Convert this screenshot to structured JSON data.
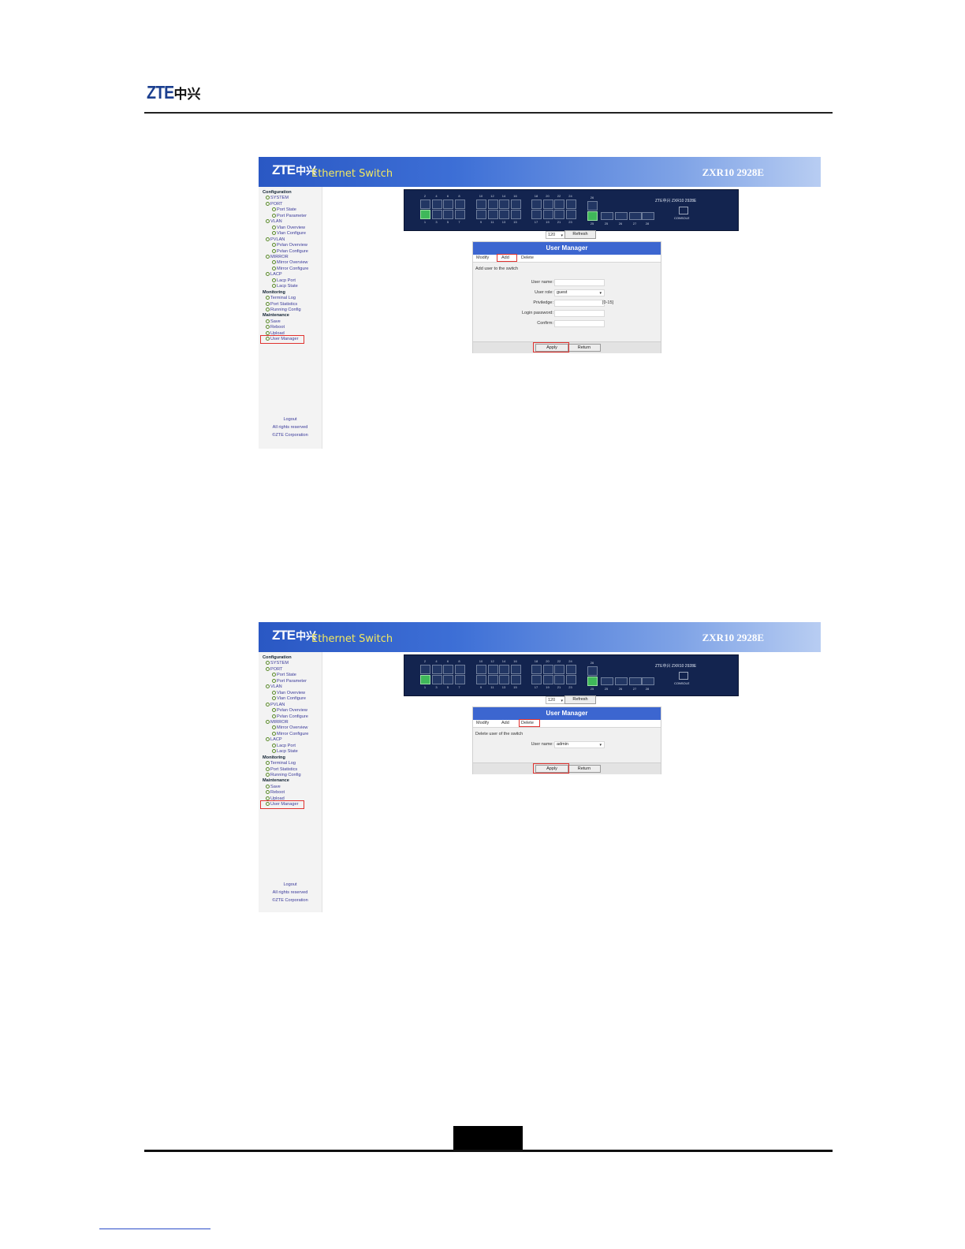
{
  "document": {
    "logo_latin": "ZTE",
    "logo_cn": "中兴"
  },
  "screens": [
    {
      "banner": {
        "logo": "ZTE",
        "logo_cn": "中兴",
        "product": "Ethernet Switch",
        "model": "ZXR10 2928E"
      },
      "sidebar": {
        "items": [
          {
            "label": "Configuration",
            "type": "head"
          },
          {
            "label": "SYSTEM",
            "type": "item"
          },
          {
            "label": "PORT",
            "type": "item"
          },
          {
            "label": "Port State",
            "type": "sub"
          },
          {
            "label": "Port Parameter",
            "type": "sub"
          },
          {
            "label": "VLAN",
            "type": "item"
          },
          {
            "label": "Vlan Overview",
            "type": "sub"
          },
          {
            "label": "Vlan Configure",
            "type": "sub"
          },
          {
            "label": "PVLAN",
            "type": "item"
          },
          {
            "label": "Pvlan Overview",
            "type": "sub"
          },
          {
            "label": "Pvlan Configure",
            "type": "sub"
          },
          {
            "label": "MIRROR",
            "type": "item"
          },
          {
            "label": "Mirror Overview",
            "type": "sub"
          },
          {
            "label": "Mirror Configure",
            "type": "sub"
          },
          {
            "label": "LACP",
            "type": "item"
          },
          {
            "label": "Lacp Port",
            "type": "sub"
          },
          {
            "label": "Lacp State",
            "type": "sub"
          },
          {
            "label": "Monitoring",
            "type": "head"
          },
          {
            "label": "Terminal Log",
            "type": "item"
          },
          {
            "label": "Port Statistics",
            "type": "item"
          },
          {
            "label": "Running Config",
            "type": "item"
          },
          {
            "label": "Maintenance",
            "type": "head"
          },
          {
            "label": "Save",
            "type": "item"
          },
          {
            "label": "Reboot",
            "type": "item"
          },
          {
            "label": "Upload",
            "type": "item"
          },
          {
            "label": "User Manager",
            "type": "item"
          }
        ],
        "footer": [
          "Logout",
          "All rights reserved",
          "©ZTE Corporation"
        ]
      },
      "panel": {
        "top_numbers": [
          "2",
          "4",
          "6",
          "8",
          "10",
          "12",
          "14",
          "16",
          "18",
          "20",
          "22",
          "24"
        ],
        "bottom_numbers": [
          "1",
          "3",
          "5",
          "7",
          "9",
          "11",
          "13",
          "15",
          "17",
          "19",
          "21",
          "23"
        ],
        "port26_top": "26",
        "port25_bottom": "25",
        "sfp_numbers": [
          "25",
          "26",
          "27",
          "28"
        ],
        "brand": "ZTE中兴  ZXR10 2928E",
        "console": "CONSOLE"
      },
      "refresh": {
        "interval": "120",
        "button": "Refresh"
      },
      "user_manager": {
        "title": "User Manager",
        "tabs": [
          "Modify",
          "Add",
          "Delete"
        ],
        "description": "Add user to the switch",
        "fields": [
          {
            "label": "User name:",
            "value": ""
          },
          {
            "label": "User role:",
            "value": "guest"
          },
          {
            "label": "Priviledge:",
            "value": "",
            "hint": "[0-15]"
          },
          {
            "label": "Login password:",
            "value": ""
          },
          {
            "label": "Confirm:",
            "value": ""
          }
        ],
        "apply": "Apply",
        "return": "Return"
      }
    },
    {
      "banner": {
        "logo": "ZTE",
        "logo_cn": "中兴",
        "product": "Ethernet Switch",
        "model": "ZXR10 2928E"
      },
      "refresh": {
        "interval": "120",
        "button": "Refresh"
      },
      "user_manager": {
        "title": "User Manager",
        "tabs": [
          "Modify",
          "Add",
          "Delete"
        ],
        "description": "Delete user of the switch",
        "fields": [
          {
            "label": "User name:",
            "value": "admin"
          }
        ],
        "apply": "Apply",
        "return": "Return"
      }
    }
  ]
}
